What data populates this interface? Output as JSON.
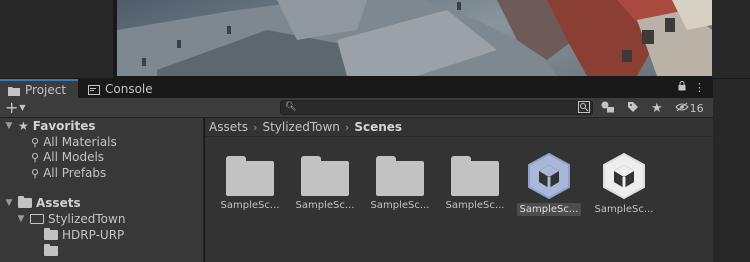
{
  "tabs": [
    {
      "label": "Project",
      "active": true,
      "icon": "folder-icon"
    },
    {
      "label": "Console",
      "active": false,
      "icon": "console-icon"
    }
  ],
  "toolbar": {
    "create_label": "+",
    "search_placeholder": "",
    "hidden_count": "16"
  },
  "tree": {
    "favorites_label": "Favorites",
    "favorites": [
      "All Materials",
      "All Models",
      "All Prefabs"
    ],
    "assets_label": "Assets",
    "stylizedtown_label": "StylizedTown",
    "hdrp_label": "HDRP-URP"
  },
  "breadcrumb": [
    "Assets",
    "StylizedTown",
    "Scenes"
  ],
  "items": [
    {
      "label": "SampleSc...",
      "type": "folder"
    },
    {
      "label": "SampleSc...",
      "type": "folder"
    },
    {
      "label": "SampleSc...",
      "type": "folder"
    },
    {
      "label": "SampleSc...",
      "type": "folder"
    },
    {
      "label": "SampleSc...",
      "type": "unity-scene",
      "selected": true
    },
    {
      "label": "SampleSc...",
      "type": "unity-scene"
    }
  ],
  "colors": {
    "accent": "#3a79bb",
    "panel": "#383838",
    "content": "#333333",
    "icon": "#c2c2c2"
  }
}
